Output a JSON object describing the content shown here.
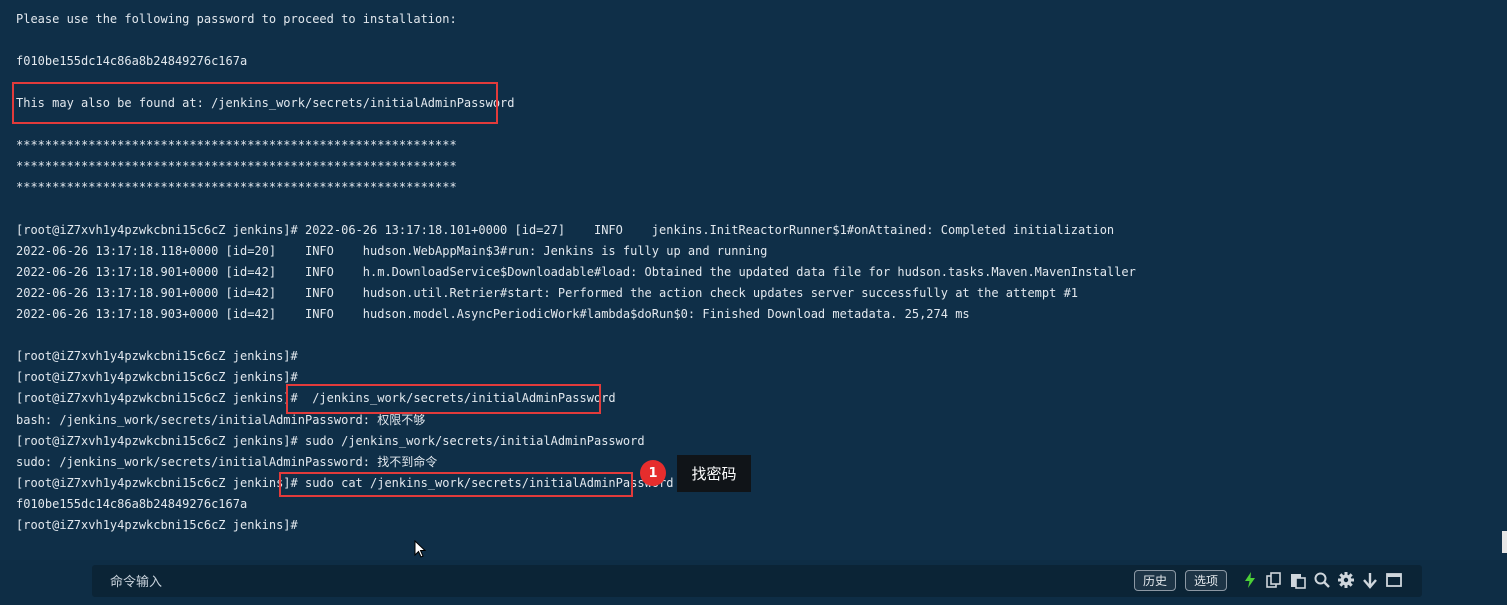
{
  "terminal": {
    "lines": [
      "Please use the following password to proceed to installation:",
      "f010be155dc14c86a8b24849276c167a",
      "This may also be found at: /jenkins_work/secrets/initialAdminPassword",
      "*************************************************************",
      "*************************************************************",
      "*************************************************************",
      "[root@iZ7xvh1y4pzwkcbni15c6cZ jenkins]# 2022-06-26 13:17:18.101+0000 [id=27]    INFO    jenkins.InitReactorRunner$1#onAttained: Completed initialization",
      "2022-06-26 13:17:18.118+0000 [id=20]    INFO    hudson.WebAppMain$3#run: Jenkins is fully up and running",
      "2022-06-26 13:17:18.901+0000 [id=42]    INFO    h.m.DownloadService$Downloadable#load: Obtained the updated data file for hudson.tasks.Maven.MavenInstaller",
      "2022-06-26 13:17:18.901+0000 [id=42]    INFO    hudson.util.Retrier#start: Performed the action check updates server successfully at the attempt #1",
      "2022-06-26 13:17:18.903+0000 [id=42]    INFO    hudson.model.AsyncPeriodicWork#lambda$doRun$0: Finished Download metadata. 25,274 ms",
      "[root@iZ7xvh1y4pzwkcbni15c6cZ jenkins]#",
      "[root@iZ7xvh1y4pzwkcbni15c6cZ jenkins]#",
      "[root@iZ7xvh1y4pzwkcbni15c6cZ jenkins]#  /jenkins_work/secrets/initialAdminPassword",
      "bash: /jenkins_work/secrets/initialAdminPassword: 权限不够",
      "[root@iZ7xvh1y4pzwkcbni15c6cZ jenkins]# sudo /jenkins_work/secrets/initialAdminPassword",
      "sudo: /jenkins_work/secrets/initialAdminPassword: 找不到命令",
      "[root@iZ7xvh1y4pzwkcbni15c6cZ jenkins]# sudo cat /jenkins_work/secrets/initialAdminPassword",
      "f010be155dc14c86a8b24849276c167a",
      "[root@iZ7xvh1y4pzwkcbni15c6cZ jenkins]#"
    ]
  },
  "annotation": {
    "step_number": "1",
    "tooltip": "找密码"
  },
  "command_bar": {
    "placeholder": "命令输入",
    "history_label": "历史",
    "options_label": "选项",
    "icons": [
      "lightning-icon",
      "copy-icon",
      "paste-icon",
      "search-icon",
      "gear-icon",
      "arrow-down-icon",
      "window-icon"
    ]
  },
  "colors": {
    "background": "#0f2f48",
    "highlight": "#e23b3b",
    "badge": "#e62d2d",
    "lightning": "#4cd137"
  }
}
